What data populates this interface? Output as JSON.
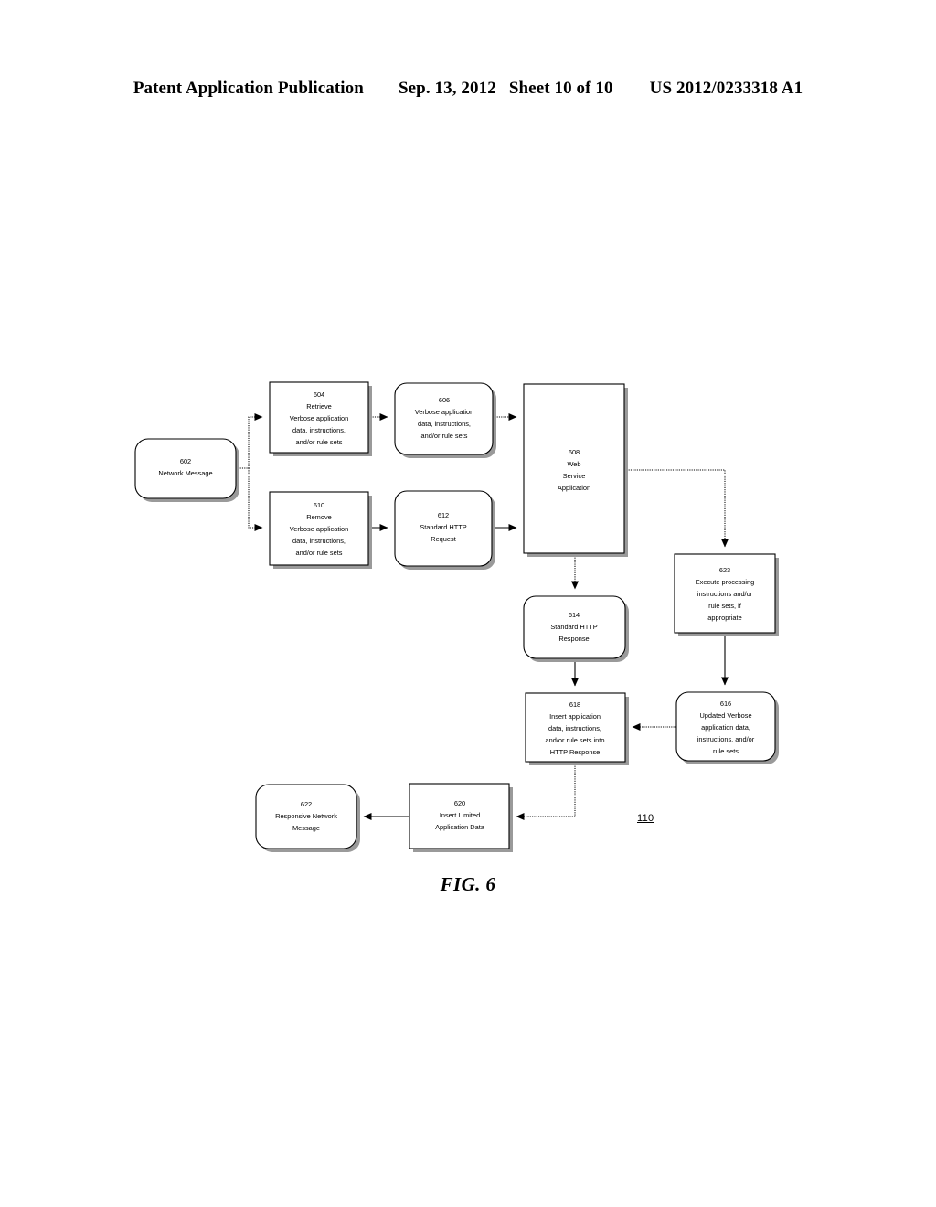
{
  "header": {
    "publication": "Patent Application Publication",
    "date": "Sep. 13, 2012",
    "sheet": "Sheet 10 of 10",
    "number": "US 2012/0233318 A1"
  },
  "figure": {
    "caption": "FIG. 6",
    "system_reference": "110"
  },
  "nodes": {
    "n602": {
      "id": "602",
      "lines": [
        "602",
        "Network Message"
      ]
    },
    "n604": {
      "id": "604",
      "lines": [
        "604",
        "Retrieve",
        "Verbose application",
        "data, instructions,",
        "and/or rule sets"
      ]
    },
    "n606": {
      "id": "606",
      "lines": [
        "606",
        "Verbose application",
        "data, instructions,",
        "and/or rule sets"
      ]
    },
    "n608": {
      "id": "608",
      "lines": [
        "608",
        "Web",
        "Service",
        "Application"
      ]
    },
    "n610": {
      "id": "610",
      "lines": [
        "610",
        "Remove",
        "Verbose application",
        "data, instructions,",
        "and/or rule sets"
      ]
    },
    "n612": {
      "id": "612",
      "lines": [
        "612",
        "Standard HTTP",
        "Request"
      ]
    },
    "n614": {
      "id": "614",
      "lines": [
        "614",
        "Standard HTTP",
        "Response"
      ]
    },
    "n616": {
      "id": "616",
      "lines": [
        "616",
        "Updated Verbose",
        "application data,",
        "instructions, and/or",
        "rule sets"
      ]
    },
    "n618": {
      "id": "618",
      "lines": [
        "618",
        "Insert application",
        "data, instructions,",
        "and/or rule sets into",
        "HTTP Response"
      ]
    },
    "n620": {
      "id": "620",
      "lines": [
        "620",
        "Insert Limited",
        "Application Data"
      ]
    },
    "n622": {
      "id": "622",
      "lines": [
        "622",
        "Responsive Network",
        "Message"
      ]
    },
    "n623": {
      "id": "623",
      "lines": [
        "623",
        "Execute processing",
        "instructions and/or",
        "rule sets, if",
        "appropriate"
      ]
    }
  },
  "colors": {
    "stroke": "#000000",
    "fill": "#ffffff",
    "shadow": "#9a9a9a"
  }
}
